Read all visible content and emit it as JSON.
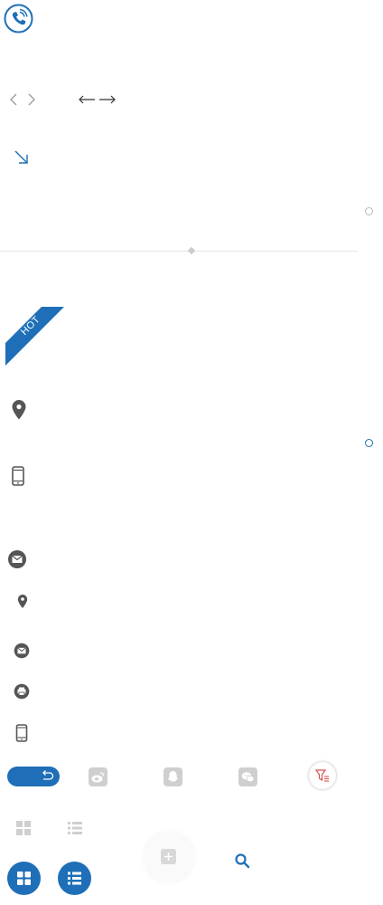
{
  "colors": {
    "accent": "#1e6fb7",
    "icon_grey": "#555555",
    "light_grey": "#cfcfcf",
    "filter_red": "#d9534f"
  },
  "ribbon": {
    "text": "HOT"
  },
  "icons": [
    "phone-ring-icon",
    "chevron-left-icon",
    "chevron-right-icon",
    "arrow-left-icon",
    "arrow-right-icon",
    "arrow-down-right-icon",
    "map-pin-icon",
    "mobile-phone-icon",
    "mail-icon",
    "printer-icon",
    "back-icon",
    "weibo-icon",
    "qq-icon",
    "wechat-icon",
    "filter-icon",
    "grid-icon",
    "list-icon",
    "plus-icon",
    "search-icon"
  ]
}
